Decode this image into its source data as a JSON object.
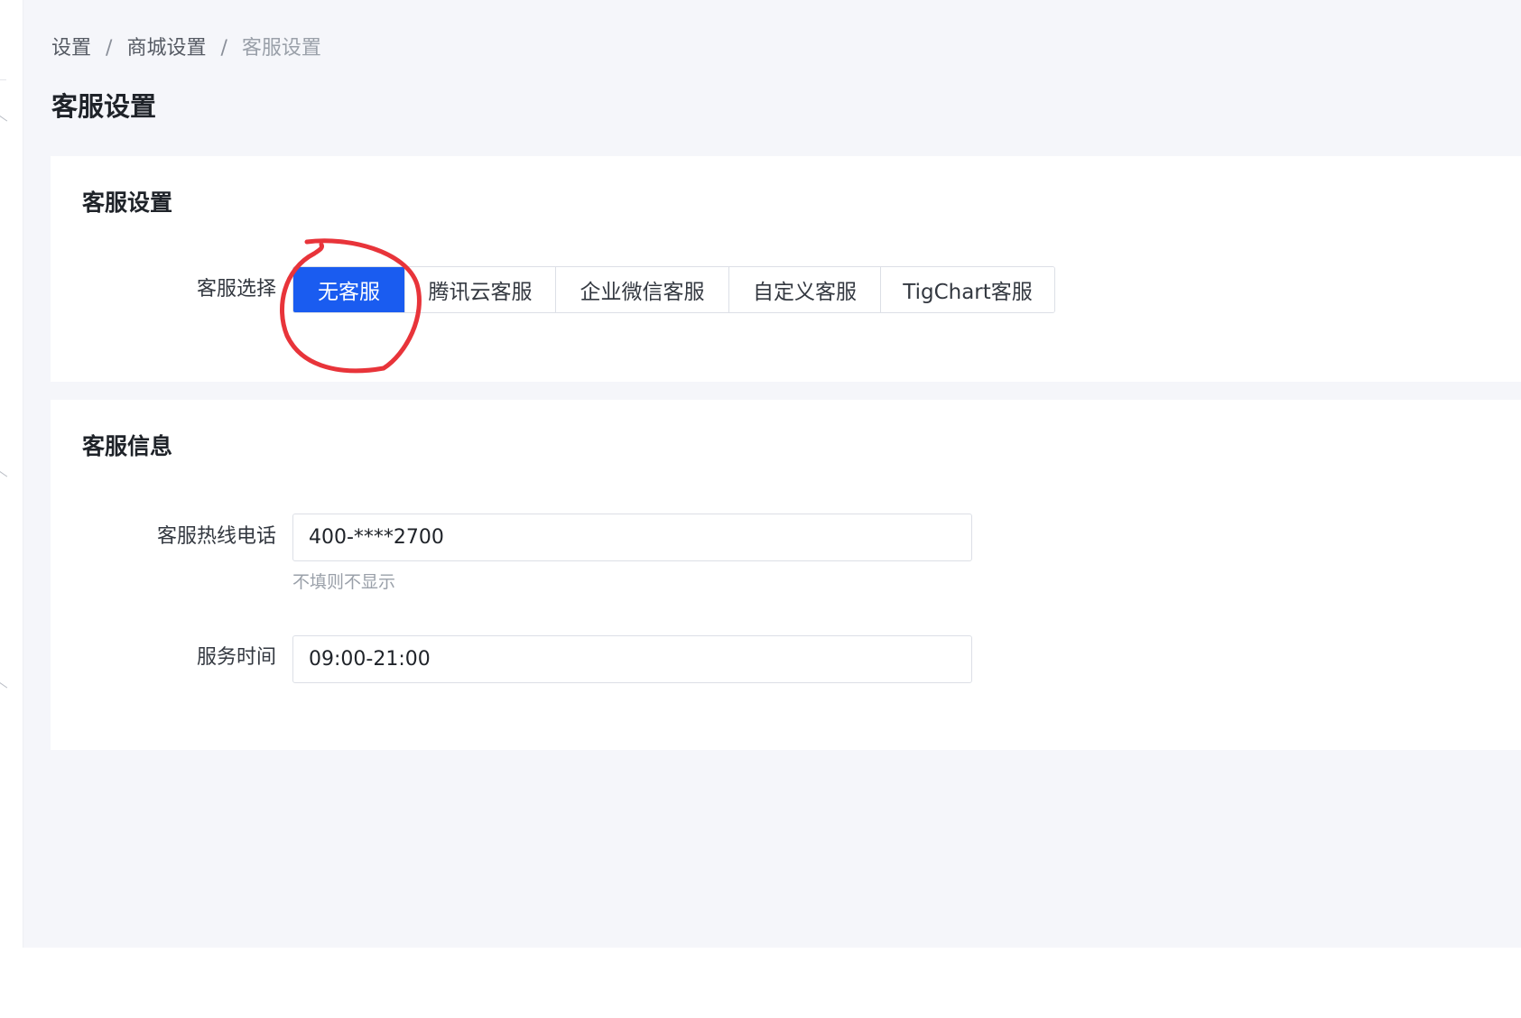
{
  "breadcrumb": {
    "items": [
      "设置",
      "商城设置",
      "客服设置"
    ],
    "separator": "/"
  },
  "page": {
    "title": "客服设置"
  },
  "settings_card": {
    "title": "客服设置",
    "selector_label": "客服选择",
    "options": [
      "无客服",
      "腾讯云客服",
      "企业微信客服",
      "自定义客服",
      "TigChart客服"
    ],
    "selected": "无客服"
  },
  "info_card": {
    "title": "客服信息",
    "hotline_label": "客服热线电话",
    "hotline_value": "400-****2700",
    "hotline_hint": "不填则不显示",
    "service_time_label": "服务时间",
    "service_time_value": "09:00-21:00"
  },
  "colors": {
    "accent": "#1a5cf0",
    "annotation": "#e8343a",
    "page_background": "#f5f6fa"
  },
  "icons": [
    "chevron-icon"
  ]
}
